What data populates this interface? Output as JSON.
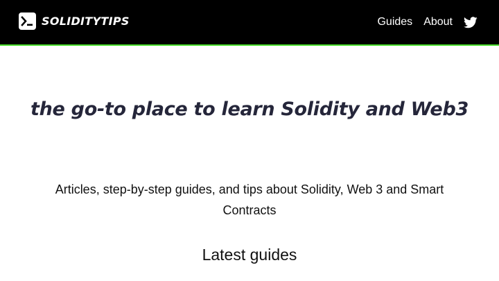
{
  "header": {
    "brand": "SOLIDITYTIPS",
    "logo_icon": "terminal-prompt-icon",
    "nav": [
      {
        "label": "Guides"
      },
      {
        "label": "About"
      }
    ],
    "social_icon": "twitter-icon",
    "accent_color": "#4ade2c",
    "background_color": "#000000"
  },
  "hero": {
    "title": "the go-to place to learn Solidity and Web3",
    "subtitle": "Articles, step-by-step guides, and tips about Solidity, Web 3 and Smart Contracts"
  },
  "latest": {
    "heading": "Latest guides"
  }
}
